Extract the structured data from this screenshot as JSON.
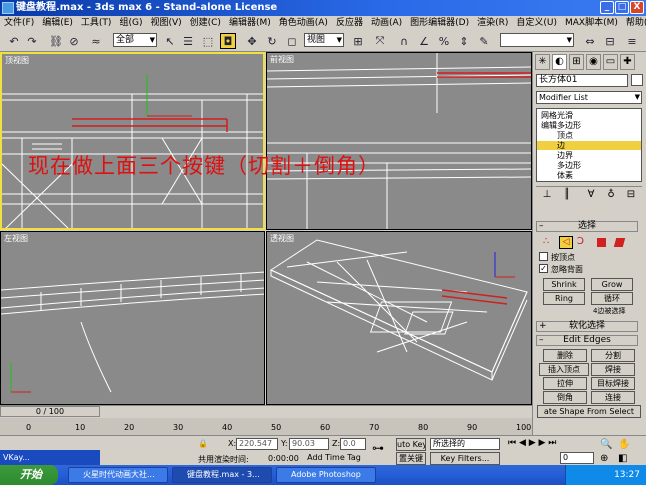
{
  "window": {
    "title": "键盘教程.max - 3ds max 6 - Stand-alone License",
    "minimize": "_",
    "maximize": "□",
    "close": "X"
  },
  "menu": [
    "文件(F)",
    "编辑(E)",
    "工具(T)",
    "组(G)",
    "视图(V)",
    "创建(C)",
    "编辑器(M)",
    "角色动画(A)",
    "反应器",
    "动画(A)",
    "图形编辑器(D)",
    "渲染(R)",
    "自定义(U)",
    "MAX脚本(M)",
    "帮助(H)"
  ],
  "toolbar": {
    "selection_filter": "全部",
    "ref_coord": "视图",
    "named_sel": ""
  },
  "viewports": {
    "top": "顶视图",
    "front": "前视图",
    "left": "左视图",
    "perspective": "透视图"
  },
  "overlay_text": "现在做上面三个按键（切割＋倒角）",
  "panel": {
    "object_name": "长方体01",
    "modifier_list": "Modifier List",
    "stack": [
      {
        "label": "网格光滑",
        "indent": 0,
        "hl": false
      },
      {
        "label": "编辑多边形",
        "indent": 0,
        "hl": false
      },
      {
        "label": "顶点",
        "indent": 2,
        "hl": false
      },
      {
        "label": "边",
        "indent": 2,
        "hl": true
      },
      {
        "label": "边界",
        "indent": 2,
        "hl": false
      },
      {
        "label": "多边形",
        "indent": 2,
        "hl": false
      },
      {
        "label": "体素",
        "indent": 2,
        "hl": false
      }
    ],
    "rollouts": {
      "selection": "选择",
      "soft_selection": "软化选择",
      "edit_edges": "Edit Edges"
    },
    "by_vertex": "按顶点",
    "ignore_backfacing": "忽略背面",
    "shrink": "Shrink",
    "grow": "Grow",
    "ring": "Ring",
    "loop": "循环",
    "selected_info": "4边被选择",
    "remove": "删除",
    "split": "分割",
    "insert_vertex": "插入顶点",
    "weld": "焊接",
    "extrude": "拉伸",
    "target_weld": "目标焊接",
    "chamfer": "倒角",
    "connect": "连接",
    "create_shape": "ate Shape From Select"
  },
  "timeslider": {
    "frame": "0 / 100"
  },
  "track_ticks": [
    "0",
    "10",
    "20",
    "30",
    "40",
    "50",
    "60",
    "70",
    "80",
    "90",
    "100"
  ],
  "status": {
    "x_label": "X:",
    "x_value": "220.547",
    "y_label": "Y:",
    "y_value": "90.03",
    "z_label": "Z:",
    "z_value": "0.0",
    "auto_key": "uto Key",
    "selected": "所选择的",
    "set_key": "置关键",
    "key_filters": "Key Filters...",
    "prompt": "共用渲染时间:",
    "time": "0:00:00",
    "add_time_tag": "Add Time Tag",
    "frame_spinner": "0"
  },
  "taskbar": {
    "start": "开始",
    "tasks": [
      "火星时代动画大社...",
      "键盘教程.max - 3...",
      "Adobe Photoshop"
    ],
    "clock": "13:27",
    "vkay": "VKay..."
  }
}
